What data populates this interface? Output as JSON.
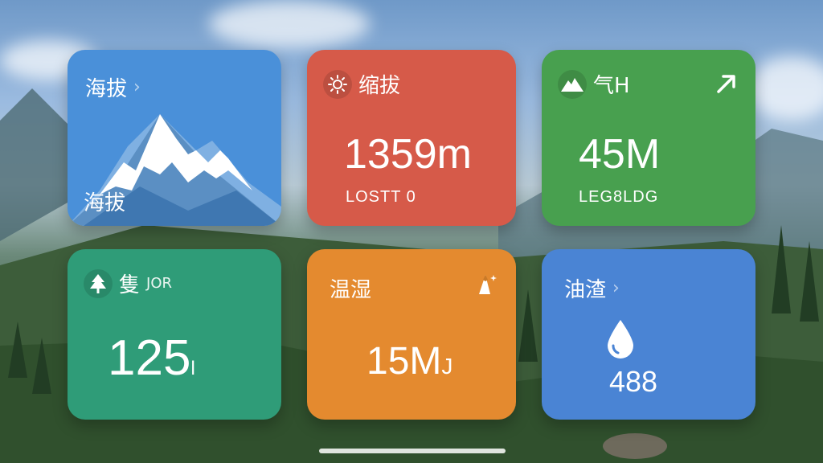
{
  "cards": [
    {
      "label": "海拔",
      "chevron": "›",
      "footer": "海拔",
      "color": "#4a90d9",
      "icon": "mountain-illustration"
    },
    {
      "label": "缩拔",
      "value": "1359m",
      "sub": "LOSTT 0",
      "color": "#d65a49",
      "icon": "sun-icon"
    },
    {
      "label": "气H",
      "value": "45M",
      "sub": "LEG8LDG",
      "color": "#48a04f",
      "icon": "mountain-icon",
      "action_icon": "trend-up-arrow-icon"
    },
    {
      "label": "隻",
      "label_extra": "JOR",
      "value": "125",
      "value_unit": "l",
      "color": "#2f9c78",
      "icon": "tree-icon"
    },
    {
      "label": "温湿",
      "value": "15M",
      "value_unit": "J",
      "color": "#e48a2f",
      "icon": "peak-sparkle-icon"
    },
    {
      "label": "油渣",
      "chevron": "›",
      "value": "488",
      "color": "#4a84d4",
      "icon": "water-drop-icon"
    }
  ]
}
